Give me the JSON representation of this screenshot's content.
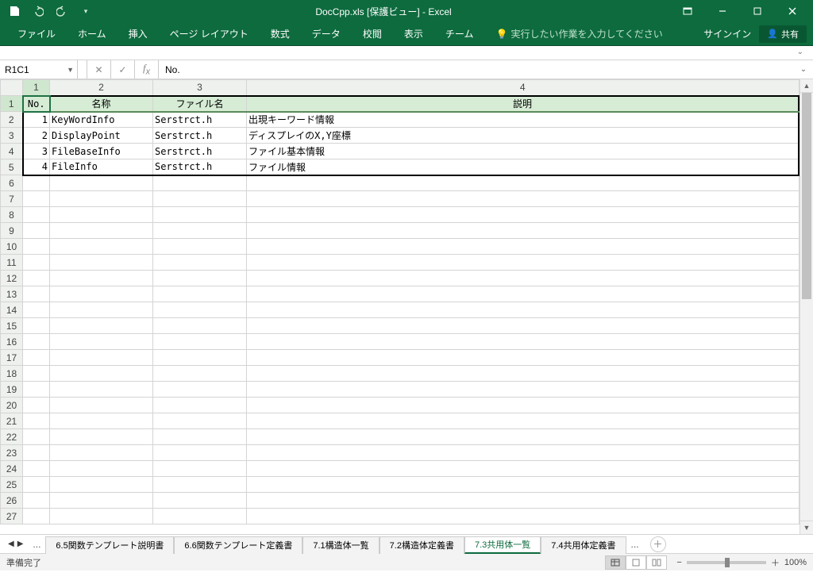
{
  "titlebar": {
    "title": "DocCpp.xls  [保護ビュー] - Excel"
  },
  "ribbon": {
    "tabs": [
      "ファイル",
      "ホーム",
      "挿入",
      "ページ レイアウト",
      "数式",
      "データ",
      "校閲",
      "表示",
      "チーム"
    ],
    "tell_me": "実行したい作業を入力してください",
    "signin": "サインイン",
    "share": "共有"
  },
  "formula": {
    "name_box": "R1C1",
    "content": "No."
  },
  "columns": {
    "c1": "1",
    "c2": "2",
    "c3": "3",
    "c4": "4"
  },
  "headers": {
    "no": "No.",
    "name": "名称",
    "file": "ファイル名",
    "desc": "説明"
  },
  "rows": [
    {
      "no": "1",
      "name": "KeyWordInfo",
      "file": "Serstrct.h",
      "desc": "出現キーワード情報"
    },
    {
      "no": "2",
      "name": "DisplayPoint",
      "file": "Serstrct.h",
      "desc": "ディスプレイのX,Y座標"
    },
    {
      "no": "3",
      "name": "FileBaseInfo",
      "file": "Serstrct.h",
      "desc": "ファイル基本情報"
    },
    {
      "no": "4",
      "name": "FileInfo",
      "file": "Serstrct.h",
      "desc": "ファイル情報"
    }
  ],
  "row_headers": [
    "1",
    "2",
    "3",
    "4",
    "5",
    "6",
    "7",
    "8",
    "9",
    "10",
    "11",
    "12",
    "13",
    "14",
    "15",
    "16",
    "17",
    "18",
    "19",
    "20",
    "21",
    "22",
    "23",
    "24",
    "25",
    "26",
    "27"
  ],
  "sheet_tabs": {
    "list": [
      "6.5関数テンプレート説明書",
      "6.6関数テンプレート定義書",
      "7.1構造体一覧",
      "7.2構造体定義書",
      "7.3共用体一覧",
      "7.4共用体定義書"
    ],
    "active_index": 4,
    "ellipsis_left": "...",
    "ellipsis_right": "..."
  },
  "status": {
    "ready": "準備完了",
    "zoom": "100%"
  }
}
